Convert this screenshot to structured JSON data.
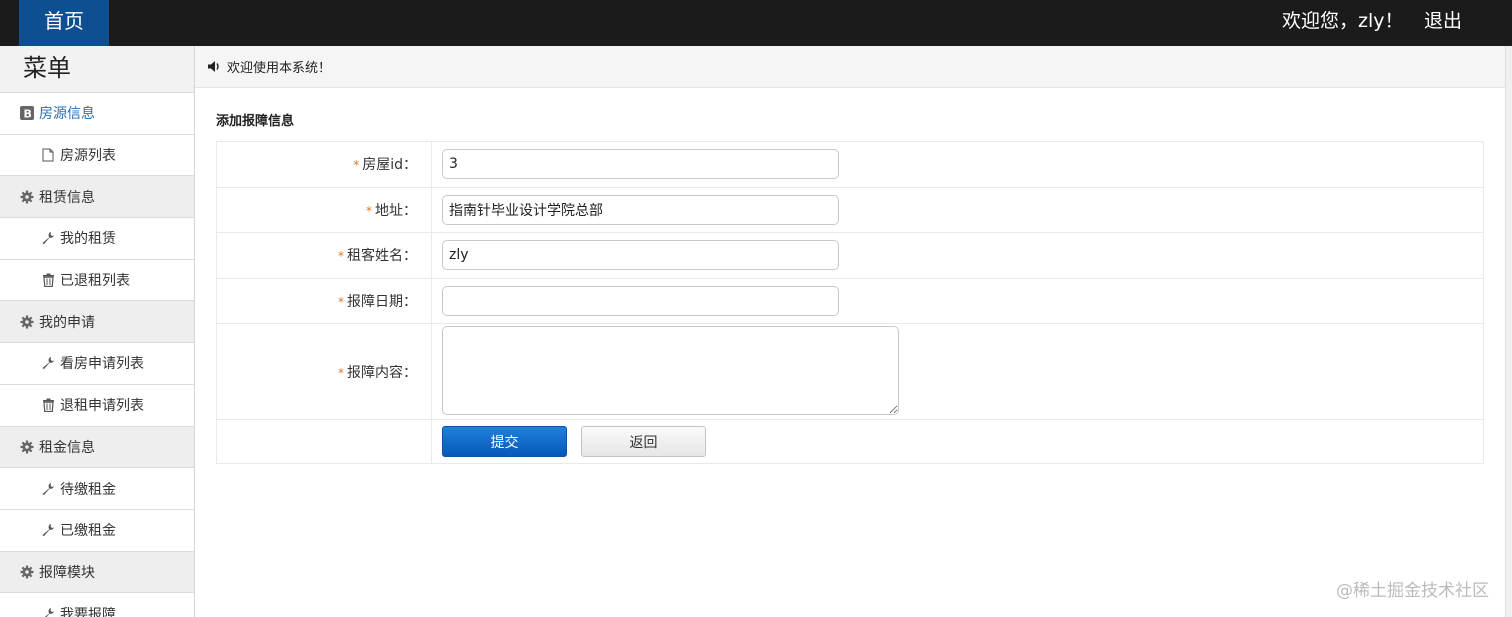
{
  "topbar": {
    "home_label": "首页",
    "welcome": "欢迎您，zly！",
    "logout_label": "退出",
    "bg_color": "#1b1b1b",
    "accent": "#0d4f91"
  },
  "sidebar": {
    "title": "菜单",
    "items": [
      {
        "label": "房源信息",
        "type": "group",
        "icon": "bold-icon"
      },
      {
        "label": "房源列表",
        "type": "child",
        "icon": "file-icon"
      },
      {
        "label": "租赁信息",
        "type": "group",
        "icon": "gear-icon"
      },
      {
        "label": "我的租赁",
        "type": "child",
        "icon": "wrench-icon"
      },
      {
        "label": "已退租列表",
        "type": "child",
        "icon": "trash-icon"
      },
      {
        "label": "我的申请",
        "type": "group",
        "icon": "gear-icon"
      },
      {
        "label": "看房申请列表",
        "type": "child",
        "icon": "wrench-icon"
      },
      {
        "label": "退租申请列表",
        "type": "child",
        "icon": "trash-icon"
      },
      {
        "label": "租金信息",
        "type": "group",
        "icon": "gear-icon"
      },
      {
        "label": "待缴租金",
        "type": "child",
        "icon": "wrench-icon"
      },
      {
        "label": "已缴租金",
        "type": "child",
        "icon": "wrench-icon"
      },
      {
        "label": "报障模块",
        "type": "group",
        "icon": "gear-icon"
      },
      {
        "label": "我要报障",
        "type": "child",
        "icon": "wrench-icon"
      }
    ]
  },
  "notice": {
    "text": "欢迎使用本系统！",
    "icon": "volume-icon"
  },
  "form": {
    "title": "添加报障信息",
    "fields": {
      "house_id": {
        "label": "房屋id：",
        "value": "3"
      },
      "address": {
        "label": "地址：",
        "value": "指南针毕业设计学院总部"
      },
      "tenant_name": {
        "label": "租客姓名：",
        "value": "zly"
      },
      "report_date": {
        "label": "报障日期：",
        "value": ""
      },
      "report_content": {
        "label": "报障内容：",
        "value": ""
      }
    },
    "required_mark": "*",
    "submit_label": "提交",
    "back_label": "返回"
  },
  "watermark": "@稀土掘金技术社区"
}
